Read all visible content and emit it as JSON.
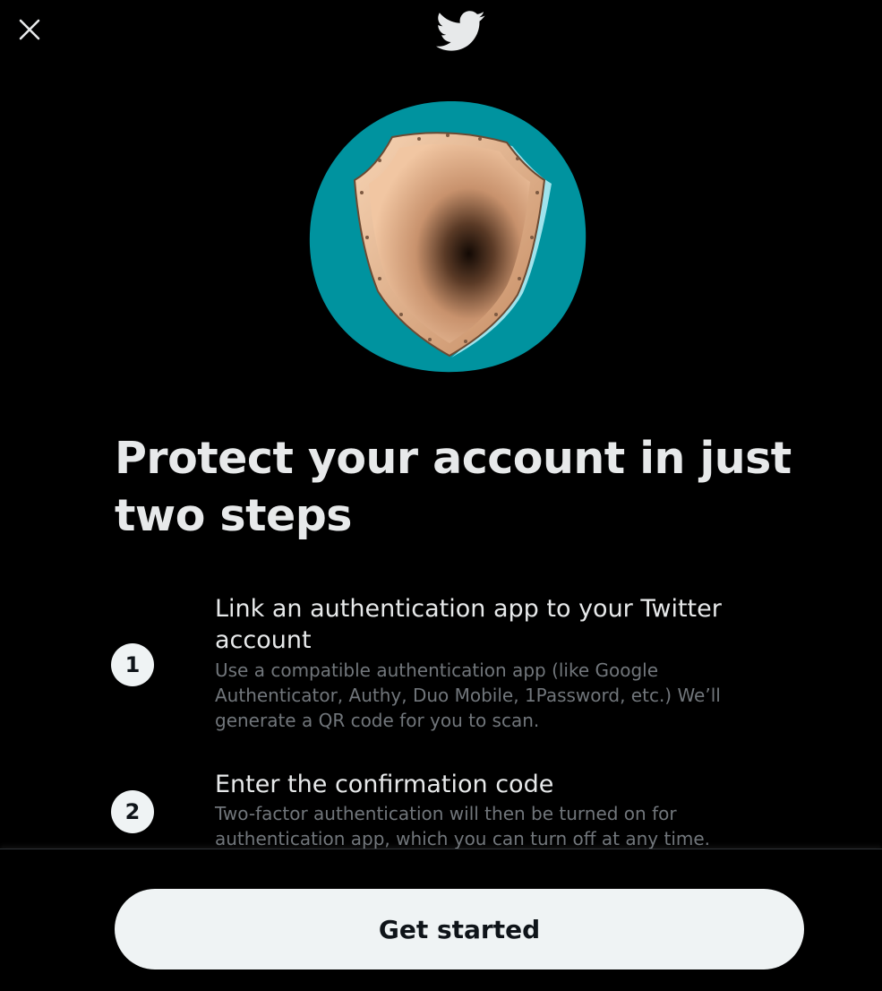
{
  "header": {
    "close_icon": "close-icon",
    "logo_icon": "twitter-bird-icon"
  },
  "hero": {
    "illustration": "shield-illustration",
    "background_color": "#00939f"
  },
  "title": "Protect your account in just two steps",
  "steps": [
    {
      "number": "1",
      "title": "Link an authentication app to your Twitter account",
      "description": "Use a compatible authentication app (like Google Authenticator, Authy, Duo Mobile, 1Password, etc.) We’ll generate a QR code for you to scan."
    },
    {
      "number": "2",
      "title": "Enter the confirmation code",
      "description": "Two-factor authentication will then be turned on for authentication app, which you can turn off at any time."
    }
  ],
  "footer": {
    "primary_label": "Get started"
  },
  "colors": {
    "background": "#000000",
    "text_primary": "#e7e9ea",
    "text_secondary": "#71767b",
    "button_bg": "#eff3f4",
    "button_text": "#0f1419"
  }
}
